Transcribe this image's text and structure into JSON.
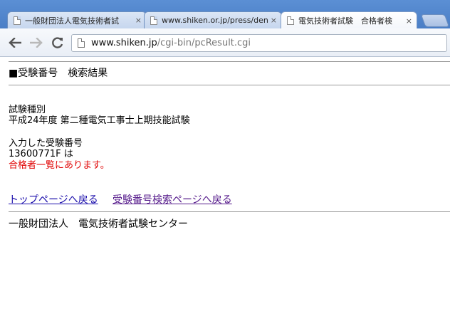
{
  "browser": {
    "tabs": [
      {
        "title": "一般財団法人電気技術者試",
        "close": "×",
        "active": false
      },
      {
        "title": "www.shiken.or.jp/press/deni",
        "close": "×",
        "active": false
      },
      {
        "title": "電気技術者試験　合格者検",
        "close": "×",
        "active": true
      }
    ],
    "address": {
      "host": "www.shiken.jp",
      "path": "/cgi-bin/pcResult.cgi"
    }
  },
  "page": {
    "heading": "■受験番号　検索結果",
    "exam_type_label": "試験種別",
    "exam_type_value": "平成24年度 第二種電気工事士上期技能試験",
    "input_label": "入力した受験番号",
    "input_value": "13600771F は",
    "result_text": "合格者一覧にあります。",
    "links": {
      "top": "トップページへ戻る",
      "search": "受験番号検索ページへ戻る"
    },
    "footer": "一般財団法人　電気技術者試験センター"
  },
  "colors": {
    "result_text": "#e00000",
    "link": "#1a0dab",
    "tabstrip": "#4a7ec6"
  }
}
